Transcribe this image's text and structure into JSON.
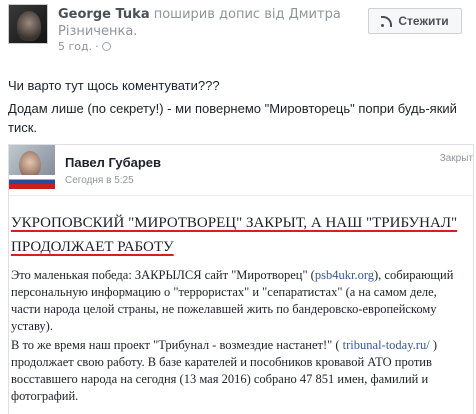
{
  "post": {
    "author": "George Tuka",
    "action_text": " поширив допис від ",
    "shared_author": "Дмитра Різниченка.",
    "time": "5 год.",
    "follow_label": "Стежити",
    "text_lines": [
      "Чи варто тут щось коментувати???",
      "Додам лише (по секрету!) - ми повернемо \"Мировторець\" попри будь-який тиск."
    ]
  },
  "embed": {
    "name": "Павел Губарев",
    "time": "Сегодня в 5:25",
    "closed_label": "Закрыт",
    "headline": "УКРОПОВСКИЙ \"МИРОТВОРЕЦ\" ЗАКРЫТ, А НАШ \"ТРИБУНАЛ\" ПРОДОЛЖАЕТ РАБОТУ",
    "p1_before": "Это маленькая победа: ЗАКРЫЛСЯ сайт \"Миротворец\" (",
    "p1_link": "psb4ukr.org",
    "p1_after": "), собирающий персональную информацию о \"террористах\" и \"сепаратистах\" (а на самом деле, части народа целой страны, не пожелавшей жить по бандеровско-европейскому уставу).",
    "p2_before": "В то же время наш проект \"Трибунал - возмездие настанет!\" ( ",
    "p2_link": "tribunal-today.ru/",
    "p2_after": " ) продолжает свою работу. В базе карателей и пособников кровавой АТО против восставшего народа на сегодня (13 мая 2016) собрано 47 851 имен, фамилий и фотографий."
  },
  "icons": [
    "avatar-image",
    "globe-icon",
    "rss-icon"
  ]
}
